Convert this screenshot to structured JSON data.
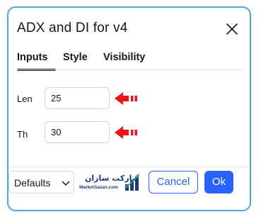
{
  "dialog": {
    "title": "ADX and DI for v4",
    "close_icon": "close-icon"
  },
  "tabs": [
    {
      "label": "Inputs",
      "active": true
    },
    {
      "label": "Style",
      "active": false
    },
    {
      "label": "Visibility",
      "active": false
    }
  ],
  "inputs": [
    {
      "label": "Len",
      "value": "25"
    },
    {
      "label": "Th",
      "value": "30"
    }
  ],
  "annotations": {
    "arrow_icon": "red-arrow-left-icon",
    "arrow_color": "#e8141b"
  },
  "footer": {
    "defaults_select": {
      "selected": "Defaults",
      "icon": "chevron-down-icon"
    },
    "watermark": {
      "text_fa": "مارکت سازان",
      "text_en": "MarketSazan.com"
    },
    "cancel_label": "Cancel",
    "ok_label": "Ok"
  },
  "colors": {
    "accent": "#2962ff",
    "border": "#5aa6d8",
    "text": "#131722",
    "arrow": "#e8141b"
  }
}
